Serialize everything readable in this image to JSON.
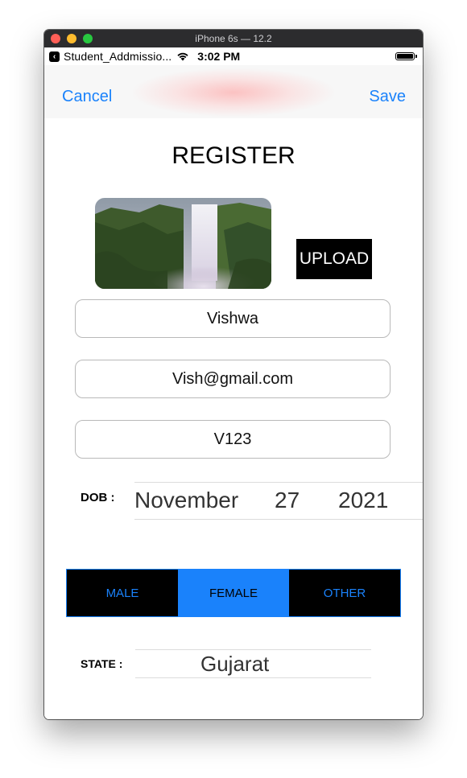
{
  "window": {
    "title": "iPhone 6s — 12.2"
  },
  "status_bar": {
    "app": "Student_Addmissio...",
    "time": "3:02 PM"
  },
  "nav": {
    "cancel": "Cancel",
    "save": "Save"
  },
  "form": {
    "title": "REGISTER",
    "upload_label": "UPLOAD",
    "name": "Vishwa",
    "email": "Vish@gmail.com",
    "password": "V123",
    "dob_label": "DOB :",
    "dob": {
      "month": "November",
      "day": "27",
      "year": "2021"
    },
    "gender": {
      "options": [
        "MALE",
        "FEMALE",
        "OTHER"
      ],
      "selected": "FEMALE"
    },
    "state_label": "STATE :",
    "state": "Gujarat"
  },
  "colors": {
    "accent": "#1a82fb",
    "segment_bg": "#000000"
  },
  "icons": [
    "back-to-app-icon",
    "wifi-icon",
    "battery-icon"
  ]
}
